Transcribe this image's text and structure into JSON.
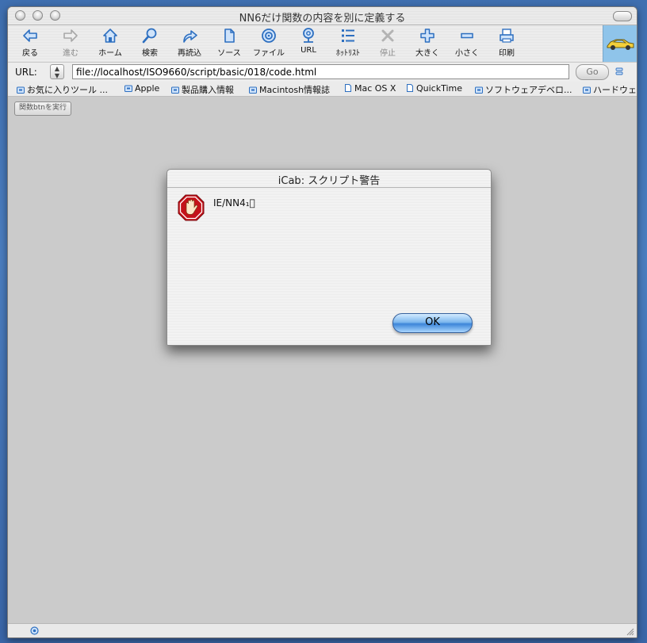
{
  "window": {
    "title": "NN6だけ関数の内容を別に定義する"
  },
  "toolbar": {
    "items": [
      {
        "label": "戻る",
        "icon": "back-arrow-icon",
        "enabled": true
      },
      {
        "label": "進む",
        "icon": "forward-arrow-icon",
        "enabled": false
      },
      {
        "label": "ホーム",
        "icon": "home-icon",
        "enabled": true
      },
      {
        "label": "検索",
        "icon": "search-icon",
        "enabled": true
      },
      {
        "label": "再読込",
        "icon": "reload-icon",
        "enabled": true
      },
      {
        "label": "ソース",
        "icon": "source-document-icon",
        "enabled": true
      },
      {
        "label": "ファイル",
        "icon": "file-target-icon",
        "enabled": true
      },
      {
        "label": "URL",
        "icon": "url-globe-icon",
        "enabled": true
      },
      {
        "label": "ﾎｯﾄﾘｽﾄ",
        "icon": "hotlist-icon",
        "enabled": true
      },
      {
        "label": "停止",
        "icon": "stop-x-icon",
        "enabled": false
      },
      {
        "label": "大きく",
        "icon": "plus-icon",
        "enabled": true
      },
      {
        "label": "小さく",
        "icon": "minus-icon",
        "enabled": true
      },
      {
        "label": "印刷",
        "icon": "printer-icon",
        "enabled": true
      }
    ],
    "brand_icon": "yellow-car-icon"
  },
  "urlbar": {
    "label": "URL:",
    "value": "file://localhost/ISO9660/script/basic/018/code.html",
    "go_label": "Go"
  },
  "bookmarks": [
    "お気に入りツール ...",
    "Apple",
    "製品購入情報",
    "Macintosh情報誌",
    "Mac OS X",
    "QuickTime",
    "ソフトウェアデベロ...",
    "ハードウェ"
  ],
  "page": {
    "button_label": "関数btnを実行"
  },
  "dialog": {
    "title": "iCab: スクリプト警告",
    "message": "IE/NN4₁⃞",
    "ok_label": "OK",
    "icon": "stop-hand-icon"
  },
  "colors": {
    "desktop": "#4576b8",
    "content_bg": "#cbcbcb",
    "toolbar_icon": "#2d6fc0",
    "ok_button": "#5b9be3",
    "stop_sign": "#c4121a"
  }
}
